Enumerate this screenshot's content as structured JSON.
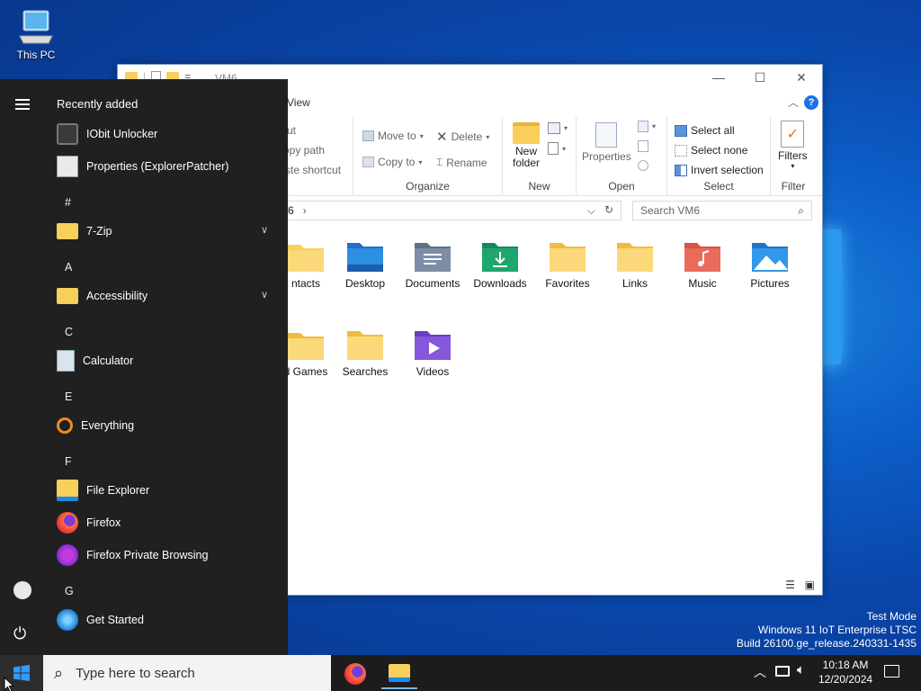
{
  "desktop": {
    "this_pc_label": "This PC"
  },
  "explorer": {
    "title": "VM6",
    "tab_view": "View",
    "ribbon": {
      "clipboard_cut": "ut",
      "clipboard_copy_path": "opy path",
      "clipboard_paste_shortcut": "ste shortcut",
      "move_to": "Move to",
      "copy_to": "Copy to",
      "delete": "Delete",
      "rename": "Rename",
      "organize_label": "Organize",
      "new_folder": "New folder",
      "new_label": "New",
      "properties": "Properties",
      "open_label": "Open",
      "select_all": "Select all",
      "select_none": "Select none",
      "invert_selection": "Invert selection",
      "select_label": "Select",
      "filters": "Filters",
      "filter_label": "Filter"
    },
    "address": {
      "path": "6",
      "search_placeholder": "Search VM6"
    },
    "items": [
      {
        "name": "ntacts",
        "icon": "contacts-folder-icon"
      },
      {
        "name": "Desktop",
        "icon": "desktop-folder-icon"
      },
      {
        "name": "Documents",
        "icon": "documents-folder-icon"
      },
      {
        "name": "Downloads",
        "icon": "downloads-folder-icon"
      },
      {
        "name": "Favorites",
        "icon": "favorites-folder-icon"
      },
      {
        "name": "Links",
        "icon": "links-folder-icon"
      },
      {
        "name": "Music",
        "icon": "music-folder-icon"
      },
      {
        "name": "Pictures",
        "icon": "pictures-folder-icon"
      },
      {
        "name": "d Games",
        "icon": "saved-games-folder-icon"
      },
      {
        "name": "Searches",
        "icon": "searches-folder-icon"
      },
      {
        "name": "Videos",
        "icon": "videos-folder-icon"
      }
    ]
  },
  "start_menu": {
    "recently_added": "Recently added",
    "apps": {
      "iobit": "IObit Unlocker",
      "properties_ep": "Properties (ExplorerPatcher)",
      "zip": "7-Zip",
      "accessibility": "Accessibility",
      "calculator": "Calculator",
      "everything": "Everything",
      "file_explorer": "File Explorer",
      "firefox": "Firefox",
      "firefox_private": "Firefox Private Browsing",
      "get_started": "Get Started"
    },
    "letters": {
      "hash": "#",
      "a": "A",
      "c": "C",
      "e": "E",
      "f": "F",
      "g": "G"
    }
  },
  "taskbar": {
    "search_placeholder": "Type here to search",
    "time": "10:18 AM",
    "date": "12/20/2024"
  },
  "watermark": {
    "line1": "Test Mode",
    "line2": "Windows 11 IoT Enterprise LTSC",
    "line3": "Build 26100.ge_release.240331-1435"
  },
  "colors": {
    "accent": "#0078d4",
    "start_bg": "#202020",
    "taskbar_bg": "#1c1c1c",
    "folder_yellow": "#f8cf5a"
  }
}
